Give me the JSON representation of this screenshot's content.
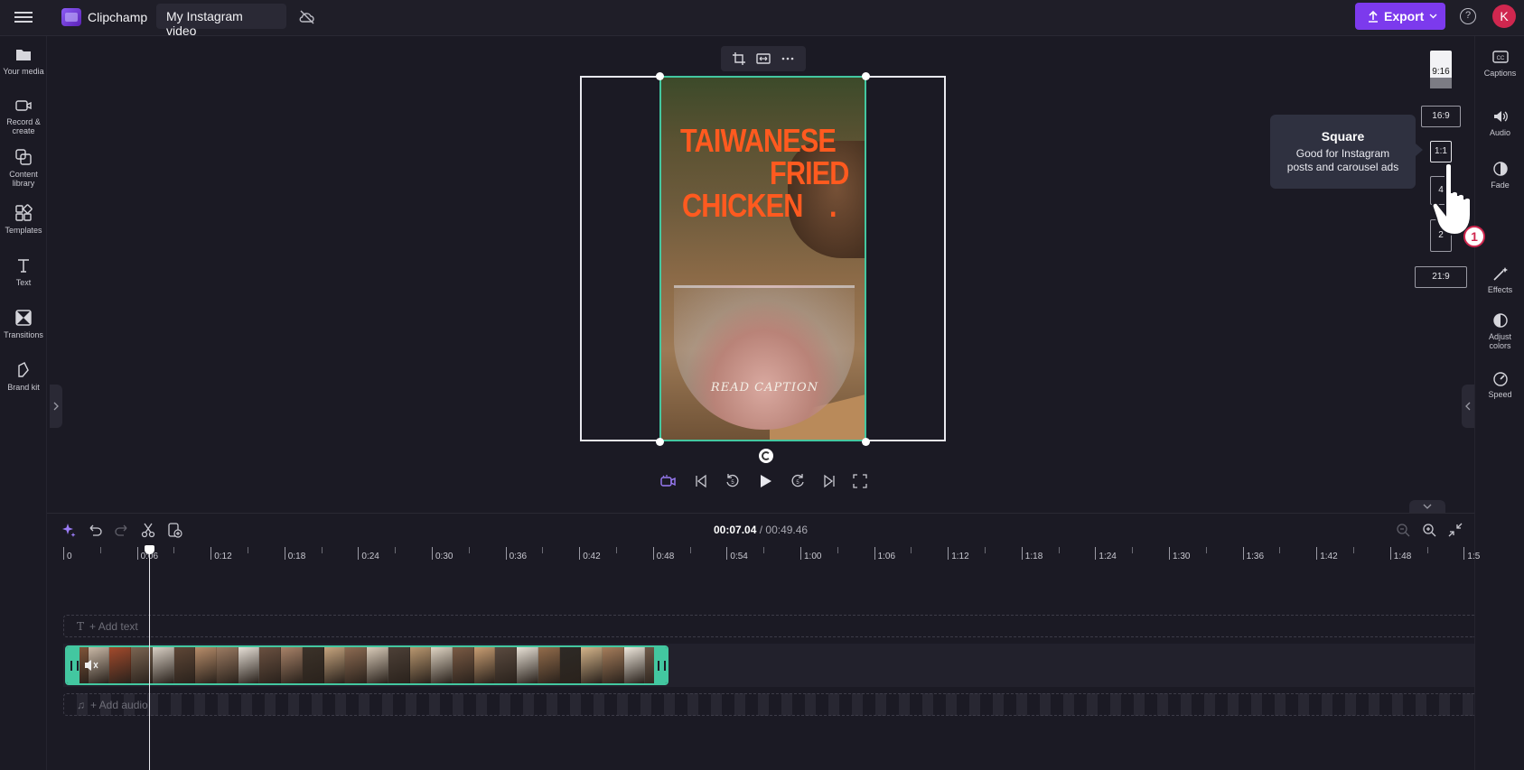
{
  "topbar": {
    "app_name": "Clipchamp",
    "project_name": "My Instagram video",
    "export_label": "Export",
    "avatar_initial": "K"
  },
  "left_sidebar": {
    "items": [
      {
        "label": "Your media",
        "icon": "folder-icon"
      },
      {
        "label": "Record & create",
        "icon": "camera-icon"
      },
      {
        "label": "Content library",
        "icon": "library-icon"
      },
      {
        "label": "Templates",
        "icon": "templates-icon"
      },
      {
        "label": "Text",
        "icon": "text-icon"
      },
      {
        "label": "Transitions",
        "icon": "transitions-icon"
      },
      {
        "label": "Brand kit",
        "icon": "brand-kit-icon"
      }
    ]
  },
  "right_sidebar": {
    "items": [
      {
        "label": "Captions",
        "icon": "captions-icon"
      },
      {
        "label": "Audio",
        "icon": "speaker-icon"
      },
      {
        "label": "Fade",
        "icon": "fade-icon"
      },
      {
        "label": "Effects",
        "icon": "effects-icon"
      },
      {
        "label": "Adjust colors",
        "icon": "adjust-colors-icon"
      },
      {
        "label": "Speed",
        "icon": "speed-icon"
      }
    ]
  },
  "preview": {
    "title_lines": [
      "TAIWANESE",
      "FRIED",
      "CHICKEN"
    ],
    "title_dot": ".",
    "caption": "READ CAPTION"
  },
  "aspect_ratios": {
    "r916": "9:16",
    "r169": "16:9",
    "r11": "1:1",
    "r45": "4",
    "r23": "2",
    "r219": "21:9"
  },
  "tooltip": {
    "title": "Square",
    "body_line1": "Good for Instagram",
    "body_line2": "posts and carousel ads"
  },
  "cursor_badge": "1",
  "timeline": {
    "current_time": "00:07.04",
    "separator": " / ",
    "total_time": "00:49.46",
    "ruler_labels": [
      "0",
      "0:06",
      "0:12",
      "0:18",
      "0:24",
      "0:30",
      "0:36",
      "0:42",
      "0:48",
      "0:54",
      "1:00",
      "1:06",
      "1:12",
      "1:18",
      "1:24",
      "1:30",
      "1:36",
      "1:42",
      "1:48",
      "1:5"
    ],
    "add_text": "+ Add text",
    "add_audio": "+ Add audio"
  },
  "colors": {
    "accent": "#7c3aed",
    "clip_border": "#43c7a0",
    "title_orange": "#ff5a1f",
    "avatar": "#d0274f"
  }
}
